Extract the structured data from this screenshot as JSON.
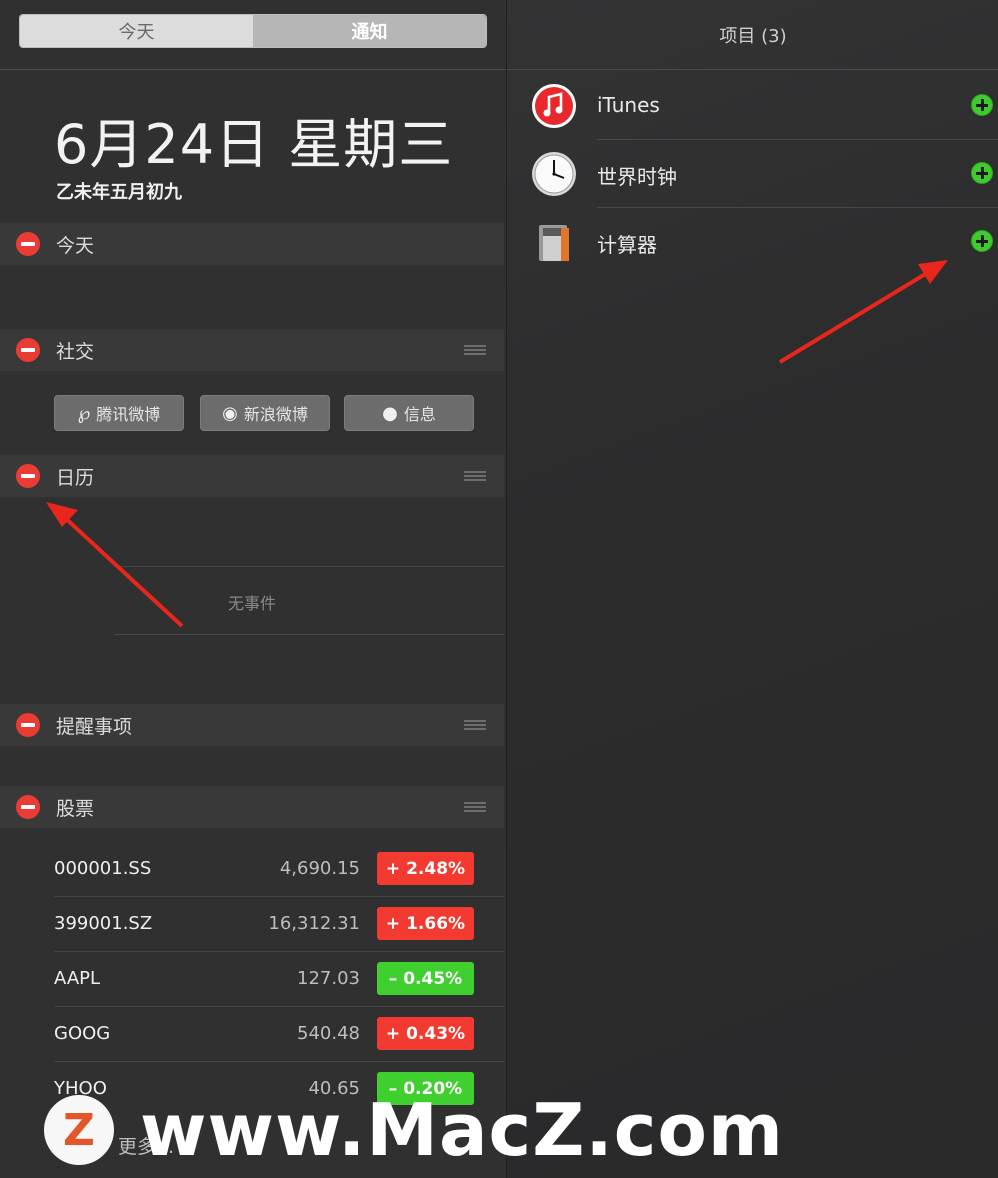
{
  "tabs": {
    "today": "今天",
    "notifications": "通知"
  },
  "date": {
    "main": "6月24日 星期三",
    "lunar": "乙未年五月初九"
  },
  "sections": {
    "today": "今天",
    "social": "社交",
    "calendar": "日历",
    "reminders": "提醒事项",
    "stocks": "股票"
  },
  "social_buttons": [
    {
      "label": "腾讯微博",
      "icon": "tencent-weibo-icon"
    },
    {
      "label": "新浪微博",
      "icon": "sina-weibo-icon"
    },
    {
      "label": "信息",
      "icon": "message-bubble-icon"
    }
  ],
  "calendar": {
    "empty_text": "无事件"
  },
  "stocks": [
    {
      "symbol": "000001.SS",
      "price": "4,690.15",
      "change": "+ 2.48%",
      "direction": "up"
    },
    {
      "symbol": "399001.SZ",
      "price": "16,312.31",
      "change": "+ 1.66%",
      "direction": "up"
    },
    {
      "symbol": "AAPL",
      "price": "127.03",
      "change": "– 0.45%",
      "direction": "down"
    },
    {
      "symbol": "GOOG",
      "price": "540.48",
      "change": "+ 0.43%",
      "direction": "up"
    },
    {
      "symbol": "YHOO",
      "price": "40.65",
      "change": "– 0.20%",
      "direction": "down"
    }
  ],
  "more_label": "更多...",
  "right_panel": {
    "title": "项目 (3)",
    "items": [
      {
        "name": "iTunes",
        "icon": "itunes-icon"
      },
      {
        "name": "世界时钟",
        "icon": "world-clock-icon"
      },
      {
        "name": "计算器",
        "icon": "calculator-icon"
      }
    ]
  },
  "colors": {
    "up": "#f23a30",
    "down": "#3fcf2f",
    "remove": "#ea3b35",
    "add": "#3fca2e",
    "arrow": "#e8261c"
  },
  "watermark": {
    "logo": "Z",
    "text": "www.MacZ.com"
  }
}
